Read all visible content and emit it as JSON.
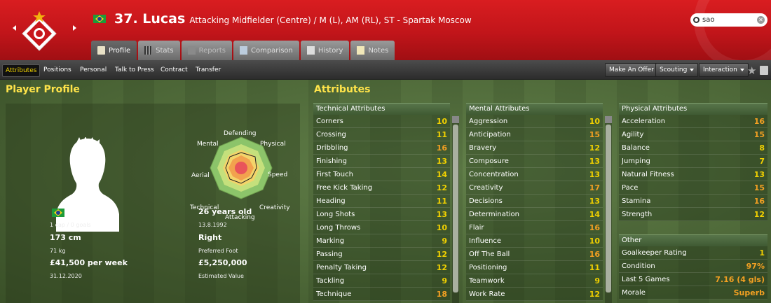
{
  "header": {
    "number_name": "37. Lucas",
    "positions_club": "Attacking Midfielder (Centre) / M (L), AM (RL), ST - Spartak Moscow",
    "search_value": "sao"
  },
  "tabs": [
    {
      "label": "Profile"
    },
    {
      "label": "Stats"
    },
    {
      "label": "Reports"
    },
    {
      "label": "Comparison"
    },
    {
      "label": "History"
    },
    {
      "label": "Notes"
    }
  ],
  "subnav": {
    "items": [
      "Attributes",
      "Positions",
      "Personal",
      "Talk to Press",
      "Contract",
      "Transfer"
    ],
    "make_offer": "Make An Offer",
    "scouting": "Scouting",
    "interaction": "Interaction"
  },
  "profile": {
    "title": "Player Profile",
    "nationality": "Brazil",
    "caps": "1 cap / 0 goals",
    "height": "173 cm",
    "weight": "71 kg",
    "wage": "£41,500 per week",
    "contract_end": "31.12.2020",
    "age": "26 years old",
    "dob": "13.8.1992",
    "foot": "Right",
    "foot_label": "Preferred Foot",
    "value": "£5,250,000",
    "value_label": "Estimated Value",
    "radar_labels": {
      "defending": "Defending",
      "physical": "Physical",
      "speed": "Speed",
      "creativity": "Creativity",
      "attacking": "Attacking",
      "technical": "Technical",
      "aerial": "Aerial",
      "mental": "Mental"
    }
  },
  "attributes": {
    "title": "Attributes",
    "technical": {
      "heading": "Technical Attributes",
      "rows": [
        {
          "name": "Corners",
          "value": "10"
        },
        {
          "name": "Crossing",
          "value": "11"
        },
        {
          "name": "Dribbling",
          "value": "16"
        },
        {
          "name": "Finishing",
          "value": "13"
        },
        {
          "name": "First Touch",
          "value": "14"
        },
        {
          "name": "Free Kick Taking",
          "value": "12"
        },
        {
          "name": "Heading",
          "value": "11"
        },
        {
          "name": "Long Shots",
          "value": "13"
        },
        {
          "name": "Long Throws",
          "value": "10"
        },
        {
          "name": "Marking",
          "value": "9"
        },
        {
          "name": "Passing",
          "value": "12"
        },
        {
          "name": "Penalty Taking",
          "value": "12"
        },
        {
          "name": "Tackling",
          "value": "9"
        },
        {
          "name": "Technique",
          "value": "18"
        }
      ]
    },
    "mental": {
      "heading": "Mental Attributes",
      "rows": [
        {
          "name": "Aggression",
          "value": "10"
        },
        {
          "name": "Anticipation",
          "value": "15"
        },
        {
          "name": "Bravery",
          "value": "12"
        },
        {
          "name": "Composure",
          "value": "13"
        },
        {
          "name": "Concentration",
          "value": "13"
        },
        {
          "name": "Creativity",
          "value": "17"
        },
        {
          "name": "Decisions",
          "value": "13"
        },
        {
          "name": "Determination",
          "value": "14"
        },
        {
          "name": "Flair",
          "value": "16"
        },
        {
          "name": "Influence",
          "value": "10"
        },
        {
          "name": "Off The Ball",
          "value": "16"
        },
        {
          "name": "Positioning",
          "value": "11"
        },
        {
          "name": "Teamwork",
          "value": "9"
        },
        {
          "name": "Work Rate",
          "value": "12"
        }
      ]
    },
    "physical": {
      "heading": "Physical Attributes",
      "rows": [
        {
          "name": "Acceleration",
          "value": "16"
        },
        {
          "name": "Agility",
          "value": "15"
        },
        {
          "name": "Balance",
          "value": "8"
        },
        {
          "name": "Jumping",
          "value": "7"
        },
        {
          "name": "Natural Fitness",
          "value": "13"
        },
        {
          "name": "Pace",
          "value": "15"
        },
        {
          "name": "Stamina",
          "value": "16"
        },
        {
          "name": "Strength",
          "value": "12"
        }
      ]
    },
    "other": {
      "heading": "Other",
      "rows": [
        {
          "name": "Goalkeeper Rating",
          "value": "1"
        },
        {
          "name": "Condition",
          "value": "97%"
        },
        {
          "name": "Last 5 Games",
          "value": "7.16 (4 gls)"
        },
        {
          "name": "Morale",
          "value": "Superb"
        }
      ]
    }
  },
  "colors": {
    "header_red": "#c1151a",
    "attr_high": "#f3a022",
    "attr_mid": "#f1d000",
    "title_yellow": "#ffe44a"
  }
}
